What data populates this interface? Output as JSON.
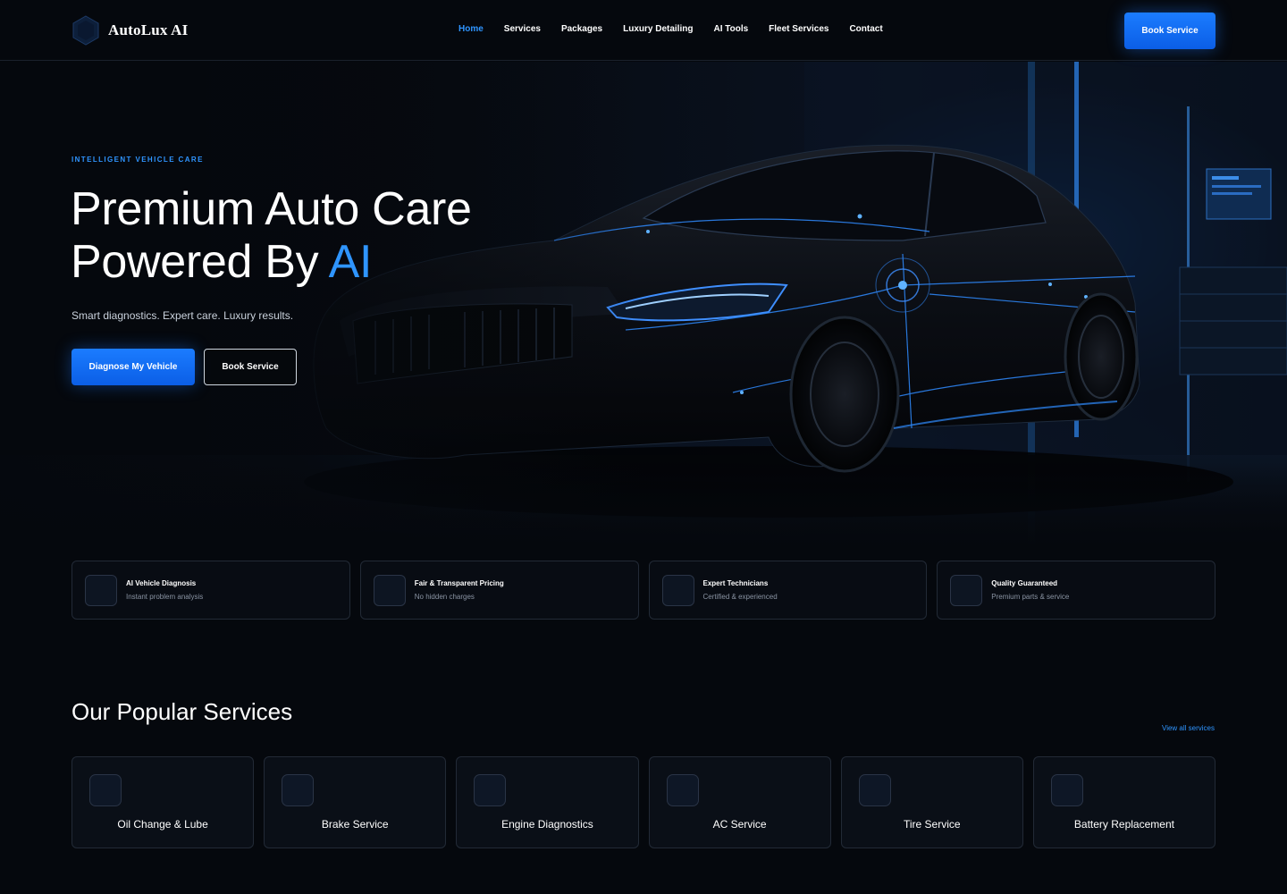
{
  "brand": {
    "name": "AutoLux AI",
    "icon": "hexagon-logo-icon"
  },
  "nav": {
    "links": [
      {
        "label": "Home",
        "active": true
      },
      {
        "label": "Services",
        "active": false
      },
      {
        "label": "Packages",
        "active": false
      },
      {
        "label": "Luxury Detailing",
        "active": false
      },
      {
        "label": "AI Tools",
        "active": false
      },
      {
        "label": "Fleet Services",
        "active": false
      },
      {
        "label": "Contact",
        "active": false
      }
    ],
    "cta_label": "Book Service"
  },
  "hero": {
    "eyebrow": "INTELLIGENT VEHICLE CARE",
    "title_line1": "Premium Auto Care",
    "title_line2_prefix": "Powered By ",
    "title_line2_accent": "AI",
    "subtitle": "Smart diagnostics. Expert care. Luxury results.",
    "primary_button": "Diagnose My Vehicle",
    "secondary_button": "Book Service"
  },
  "features": [
    {
      "title": "AI Vehicle Diagnosis",
      "desc": "Instant problem analysis"
    },
    {
      "title": "Fair & Transparent Pricing",
      "desc": "No hidden charges"
    },
    {
      "title": "Expert Technicians",
      "desc": "Certified & experienced"
    },
    {
      "title": "Quality Guaranteed",
      "desc": "Premium parts & service"
    }
  ],
  "services": {
    "title": "Our Popular Services",
    "view_all": "View all services",
    "items": [
      {
        "name": "Oil Change & Lube"
      },
      {
        "name": "Brake Service"
      },
      {
        "name": "Engine Diagnostics"
      },
      {
        "name": "AC Service"
      },
      {
        "name": "Tire Service"
      },
      {
        "name": "Battery Replacement"
      }
    ]
  },
  "colors": {
    "accent": "#2f95ff",
    "button": "#1b7cff",
    "background": "#05080d",
    "card_border": "#222a36"
  }
}
